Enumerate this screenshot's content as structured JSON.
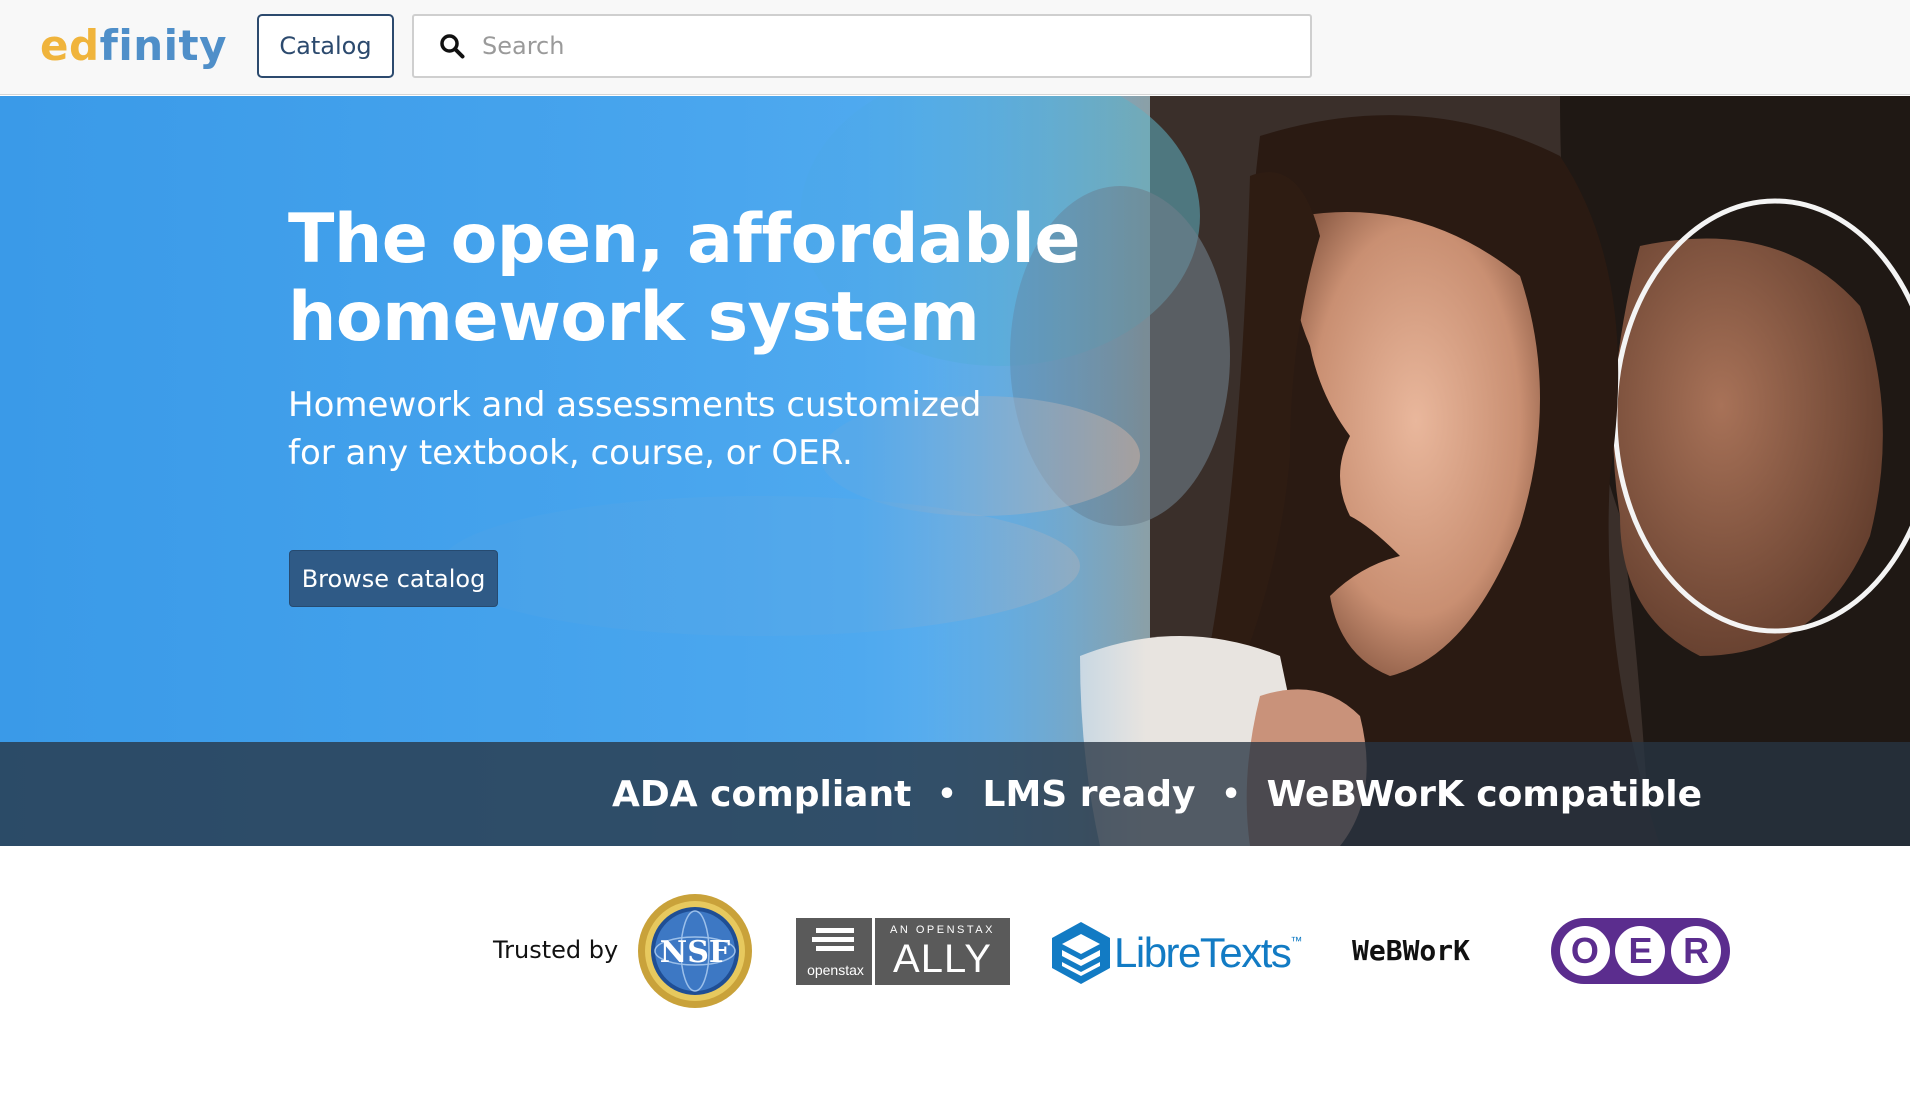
{
  "header": {
    "logo_part1": "ed",
    "logo_part2": "finity",
    "catalog_label": "Catalog",
    "search_placeholder": "Search"
  },
  "hero": {
    "title_line1": "The open, affordable",
    "title_line2": "homework system",
    "subtitle_line1": "Homework and assessments customized",
    "subtitle_line2": "for any textbook, course, or OER.",
    "browse_label": "Browse catalog",
    "features": [
      "ADA compliant",
      "LMS ready",
      "WeBWorK compatible"
    ],
    "separator": "•"
  },
  "trusted": {
    "label": "Trusted by",
    "logos": {
      "nsf": "NSF",
      "openstax_small": "openstax",
      "openstax_top": "AN OPENSTAX",
      "openstax_main": "ALLY",
      "libretexts": "LibreTexts",
      "libretexts_tm": "™",
      "webwork": "WeBWorK",
      "oer": [
        "O",
        "E",
        "R"
      ]
    }
  },
  "colors": {
    "logo_ed": "#f0b43c",
    "logo_finity": "#4f8fc9",
    "catalog_border": "#2c4a6e",
    "browse_button": "#2f5a86",
    "hero_blue": "#3b9be8",
    "oer_purple": "#5b2d8e"
  }
}
